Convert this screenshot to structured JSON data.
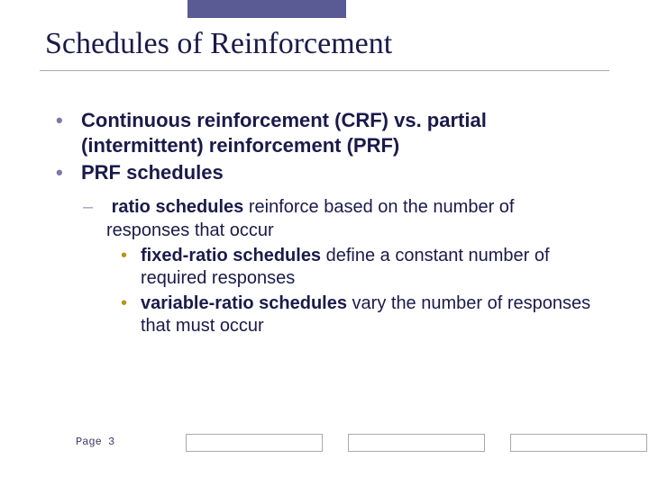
{
  "title": "Schedules of Reinforcement",
  "bullets": {
    "b1": "Continuous reinforcement (CRF) vs. partial (intermittent) reinforcement (PRF)",
    "b2": "PRF schedules",
    "sub1_bold": "ratio schedules",
    "sub1_rest": " reinforce based on the number of responses that occur",
    "sub1a_bold": "fixed-ratio schedules",
    "sub1a_rest": " define a constant number of required responses",
    "sub1b_bold": "variable-ratio schedules",
    "sub1b_rest": " vary the number of responses that must occur"
  },
  "page_label": "Page 3"
}
